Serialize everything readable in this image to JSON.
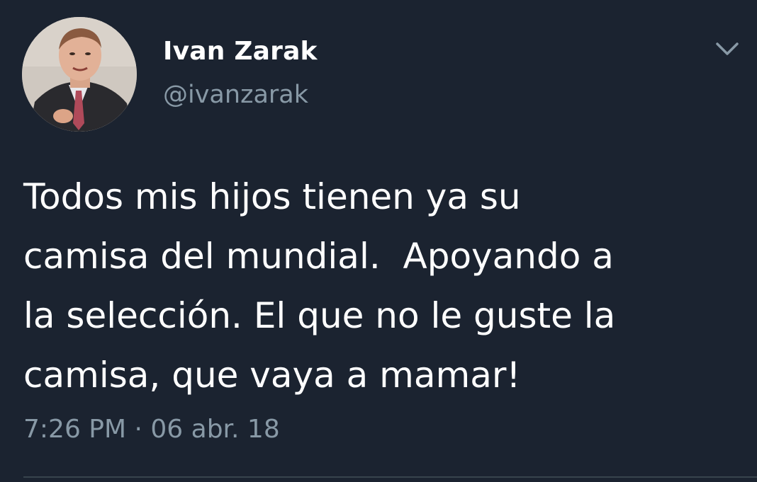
{
  "tweet": {
    "author": {
      "display_name": "Ivan Zarak",
      "handle": "@ivanzarak",
      "avatar_icon": "profile-photo"
    },
    "menu_icon": "chevron-down-icon",
    "text": "Todos mis hijos tienen ya su\ncamisa del mundial.  Apoyando a\nla selección. El que no le guste la\ncamisa, que vaya a mamar!",
    "timestamp": "7:26 PM · 06 abr. 18"
  },
  "colors": {
    "background": "#1b2330",
    "primary_text": "#ffffff",
    "secondary_text": "#8899a6",
    "divider": "#38444d"
  }
}
